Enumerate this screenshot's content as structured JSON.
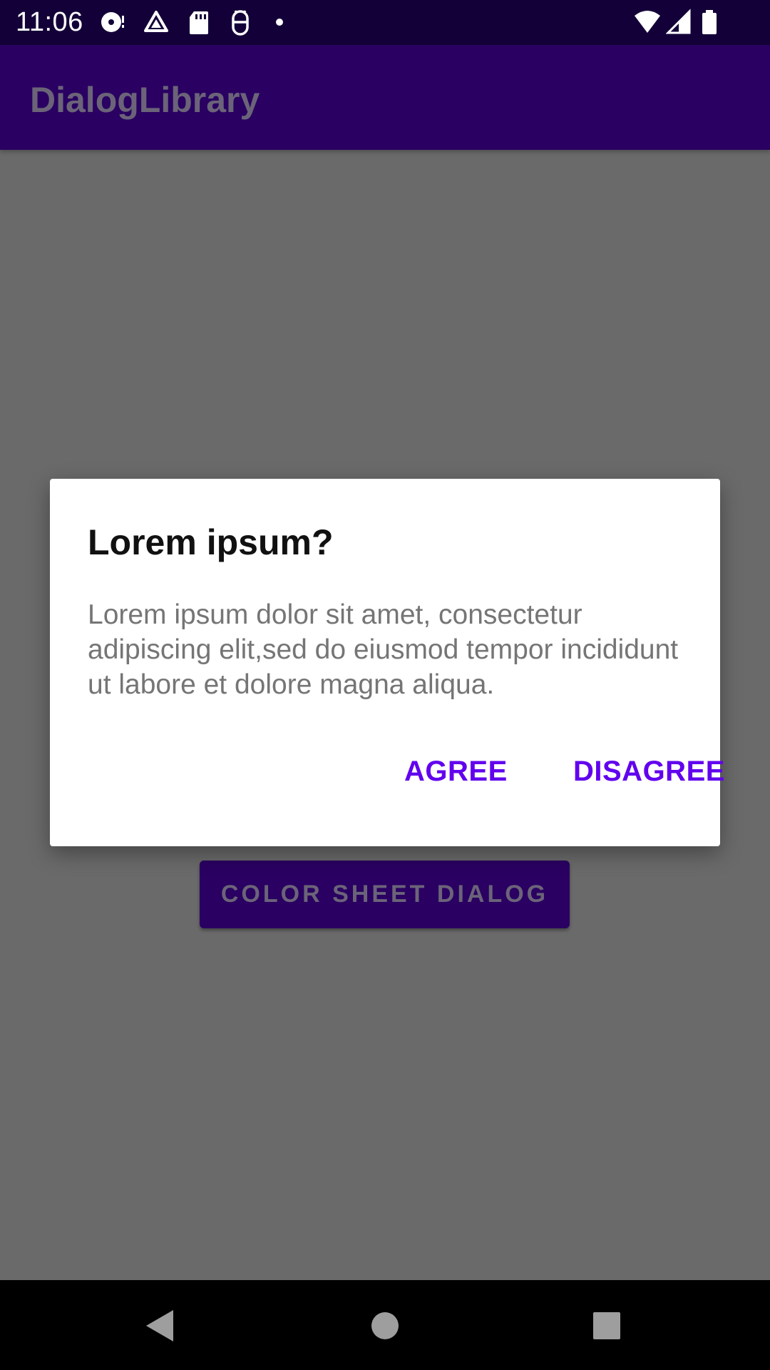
{
  "status_bar": {
    "time": "11:06",
    "icons": [
      "spotify-icon",
      "drive-icon",
      "sd-card-icon",
      "android-debug-icon",
      "dot-icon"
    ],
    "right_icons": [
      "wifi-icon",
      "cell-signal-icon",
      "battery-icon"
    ]
  },
  "app_bar": {
    "title": "DialogLibrary"
  },
  "background": {
    "button_label": "COLOR SHEET DIALOG"
  },
  "dialog": {
    "title": "Lorem ipsum?",
    "message": "Lorem ipsum dolor sit amet, consectetur adipiscing elit,sed do eiusmod tempor incididunt ut labore et dolore magna aliqua.",
    "agree_label": "AGREE",
    "disagree_label": "DISAGREE"
  },
  "colors": {
    "accent": "#6200ee",
    "app_bar": "#2a0062",
    "status_bar": "#130038",
    "scrim_background": "#6a6a6a"
  }
}
